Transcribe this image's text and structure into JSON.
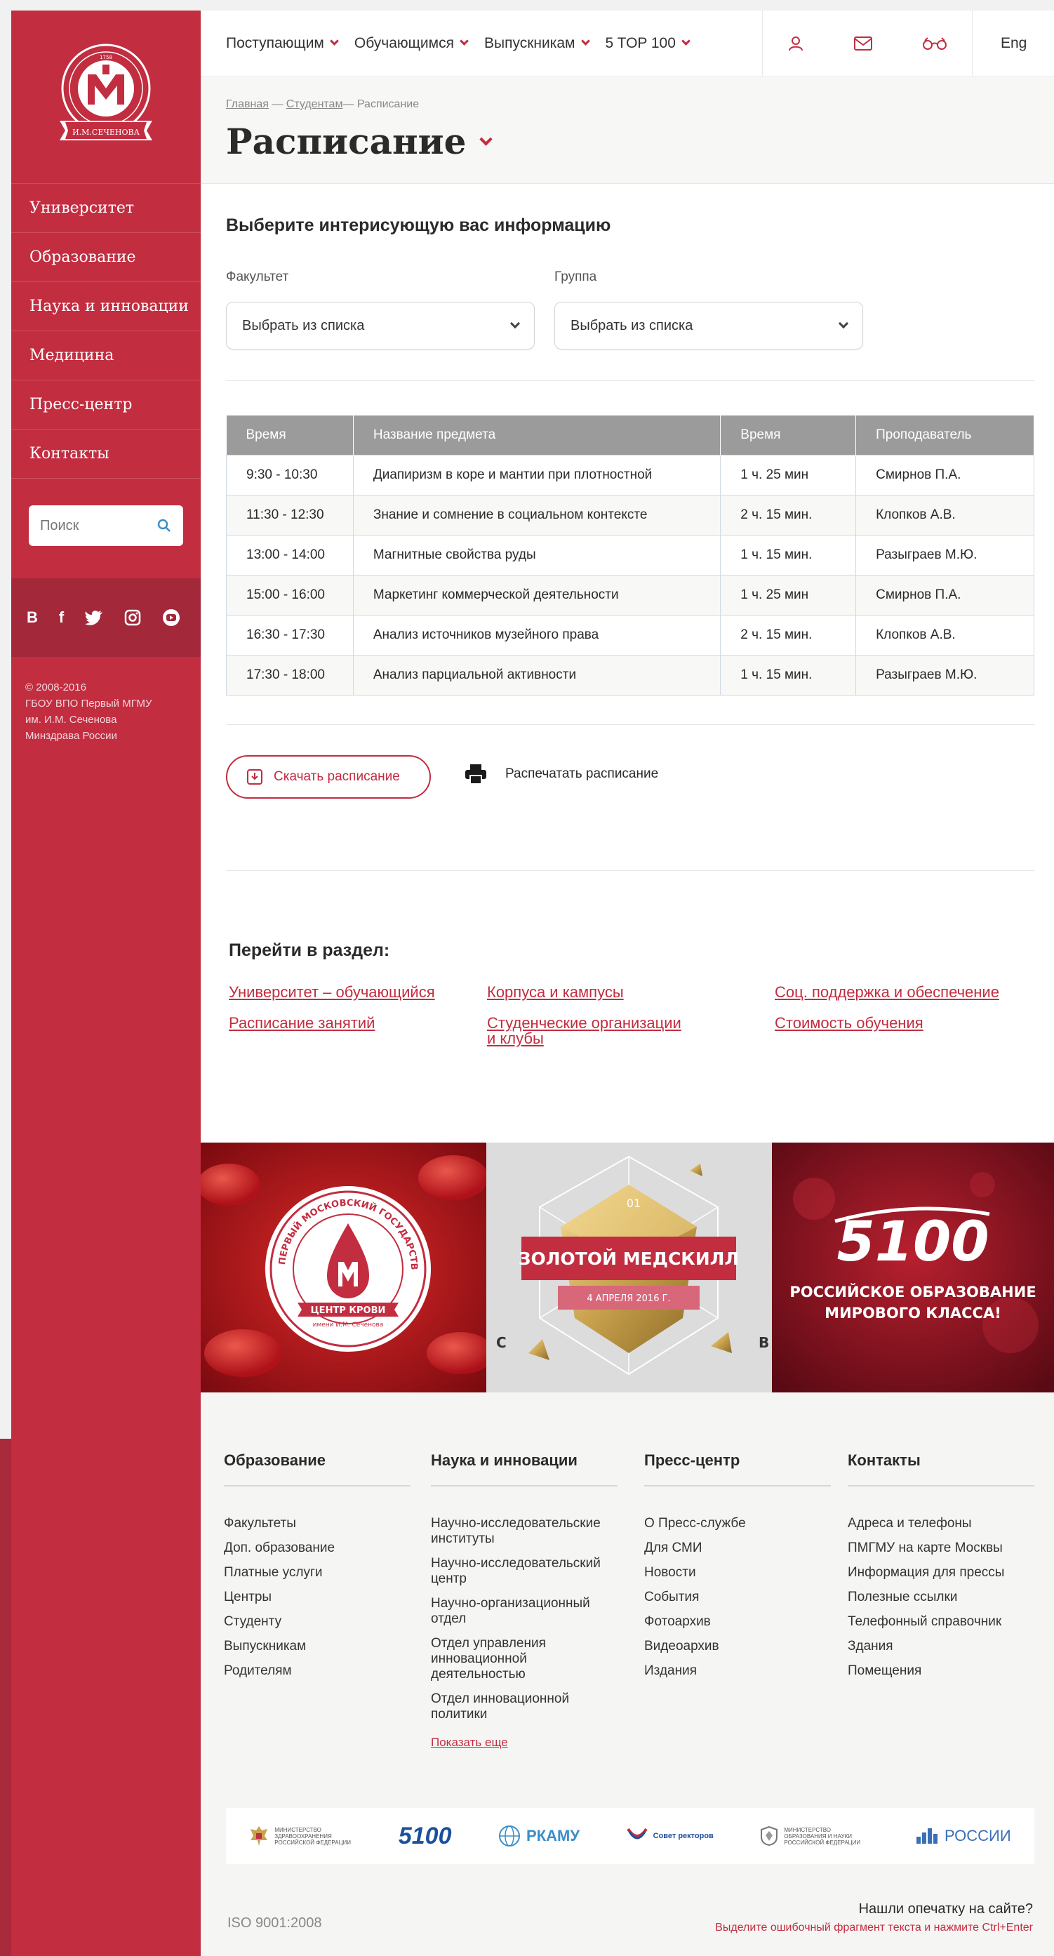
{
  "sidebar": {
    "logo_text": "И.М.СЕЧЕНОВА",
    "logo_year": "1758",
    "nav": [
      "Университет",
      "Образование",
      "Наука и инновации",
      "Медицина",
      "Пресс-центр",
      "Контакты"
    ],
    "search_placeholder": "Поиск",
    "social": [
      "В",
      "f"
    ],
    "copyright": [
      "© 2008-2016",
      "ГБОУ ВПО Первый МГМУ",
      "им. И.М. Сеченова",
      "Минздрава России"
    ]
  },
  "topnav": {
    "items": [
      "Поступающим",
      "Обучающимся",
      "Выпускникам",
      "5 TOP 100"
    ],
    "lang": "Eng"
  },
  "breadcrumb": {
    "home": "Главная",
    "sep1": " — ",
    "students": "Студентам",
    "sep2": "— ",
    "current": "Расписание"
  },
  "page": {
    "title": "Расписание",
    "section_heading": "Выберите интерисующую вас информацию",
    "faculty_label": "Факультет",
    "group_label": "Группа",
    "faculty_value": "Выбрать из списка",
    "group_value": "Выбрать из списка"
  },
  "schedule": {
    "headers": [
      "Время",
      "Название предмета",
      "Время",
      "Проподаватель"
    ],
    "rows": [
      [
        "9:30 - 10:30",
        "Диапиризм в коре и мантии при плотностной",
        "1 ч. 25 мин",
        "Смирнов П.А."
      ],
      [
        "11:30 - 12:30",
        "Знание и сомнение в социальном контексте",
        "2 ч. 15 мин.",
        "Клопков А.В."
      ],
      [
        "13:00 - 14:00",
        "Магнитные свойства руды",
        "1 ч. 15 мин.",
        "Разыграев М.Ю."
      ],
      [
        "15:00 - 16:00",
        "Маркетинг коммерческой деятельности",
        "1 ч. 25 мин",
        "Смирнов П.А."
      ],
      [
        "16:30 - 17:30",
        "Анализ источников музейного права",
        "2 ч. 15 мин.",
        "Клопков А.В."
      ],
      [
        "17:30 - 18:00",
        "Анализ парциальной активности",
        "1 ч. 15 мин.",
        "Разыграев М.Ю."
      ]
    ]
  },
  "actions": {
    "download": "Скачать расписание",
    "print": "Распечатать расписание"
  },
  "goto": {
    "heading": "Перейти в раздел:",
    "links": [
      "Университет – обучающийся",
      "Расписание занятий",
      "Корпуса и кампусы",
      "Студенческие организации",
      "и клубы",
      "Соц. поддержка и обеспечение",
      "Стоимость обучения"
    ]
  },
  "banners": {
    "b1_ring": "ПЕРВЫЙ МОСКОВСКИЙ ГОСУДАРСТВЕННЫЙ МЕДИЦИНСКИЙ УНИВЕРСИТЕТ",
    "b1_ribbon": "ЦЕНТР КРОВИ",
    "b1_sub": "имени И.М. Сеченова",
    "b2_num": "01",
    "b2_title": "ЗОЛОТОЙ МЕДСКИЛЛ",
    "b2_date": "4 АПРЕЛЯ 2016 Г.",
    "b2_c": "C",
    "b2_b": "B",
    "b3_logo": "5100",
    "b3_line1": "РОССИЙСКОЕ ОБРАЗОВАНИЕ",
    "b3_line2": "МИРОВОГО КЛАССА!"
  },
  "footer": {
    "col1": {
      "title": "Образование",
      "items": [
        "Факультеты",
        "Доп. образование",
        "Платные услуги",
        "Центры",
        "Студенту",
        "Выпускникам",
        "Родителям"
      ]
    },
    "col2": {
      "title": "Наука и инновации",
      "items": [
        "Научно-исследовательские институты",
        "Научно-исследовательский центр",
        "Научно-организационный отдел",
        "Отдел управления инновационной деятельностью",
        "Отдел инновационной политики"
      ],
      "more": "Показать еще"
    },
    "col3": {
      "title": "Пресс-центр",
      "items": [
        "О Пресс-службе",
        "Для СМИ",
        "Новости",
        "События",
        "Фотоархив",
        "Видеоархив",
        "Издания"
      ]
    },
    "col4": {
      "title": "Контакты",
      "items": [
        "Адреса и телефоны",
        "ПМГМУ на карте Москвы",
        "Информация для прессы",
        "Полезные ссылки",
        "Телефонный справочник",
        "Здания",
        "Помещения"
      ]
    },
    "partners": [
      "МИНИСТЕРСТВО ЗДРАВООХРАНЕНИЯ РОССИЙСКОЙ ФЕДЕРАЦИИ",
      "5100",
      "РКАМУ",
      "Совет ректоров",
      "МИНИСТЕРСТВО ОБРАЗОВАНИЯ И НАУКИ РОССИЙСКОЙ ФЕДЕРАЦИИ",
      "РОССИИ"
    ],
    "iso": "ISO 9001:2008",
    "typo_q": "Нашли опечатку на сайте?",
    "typo_hint": "Выделите ошибочный фрагмент текста и нажмите Ctrl+Enter"
  },
  "colors": {
    "brand_red": "#c22d40",
    "dark_red": "#a2283a",
    "grey_header": "#9b9b9b"
  }
}
